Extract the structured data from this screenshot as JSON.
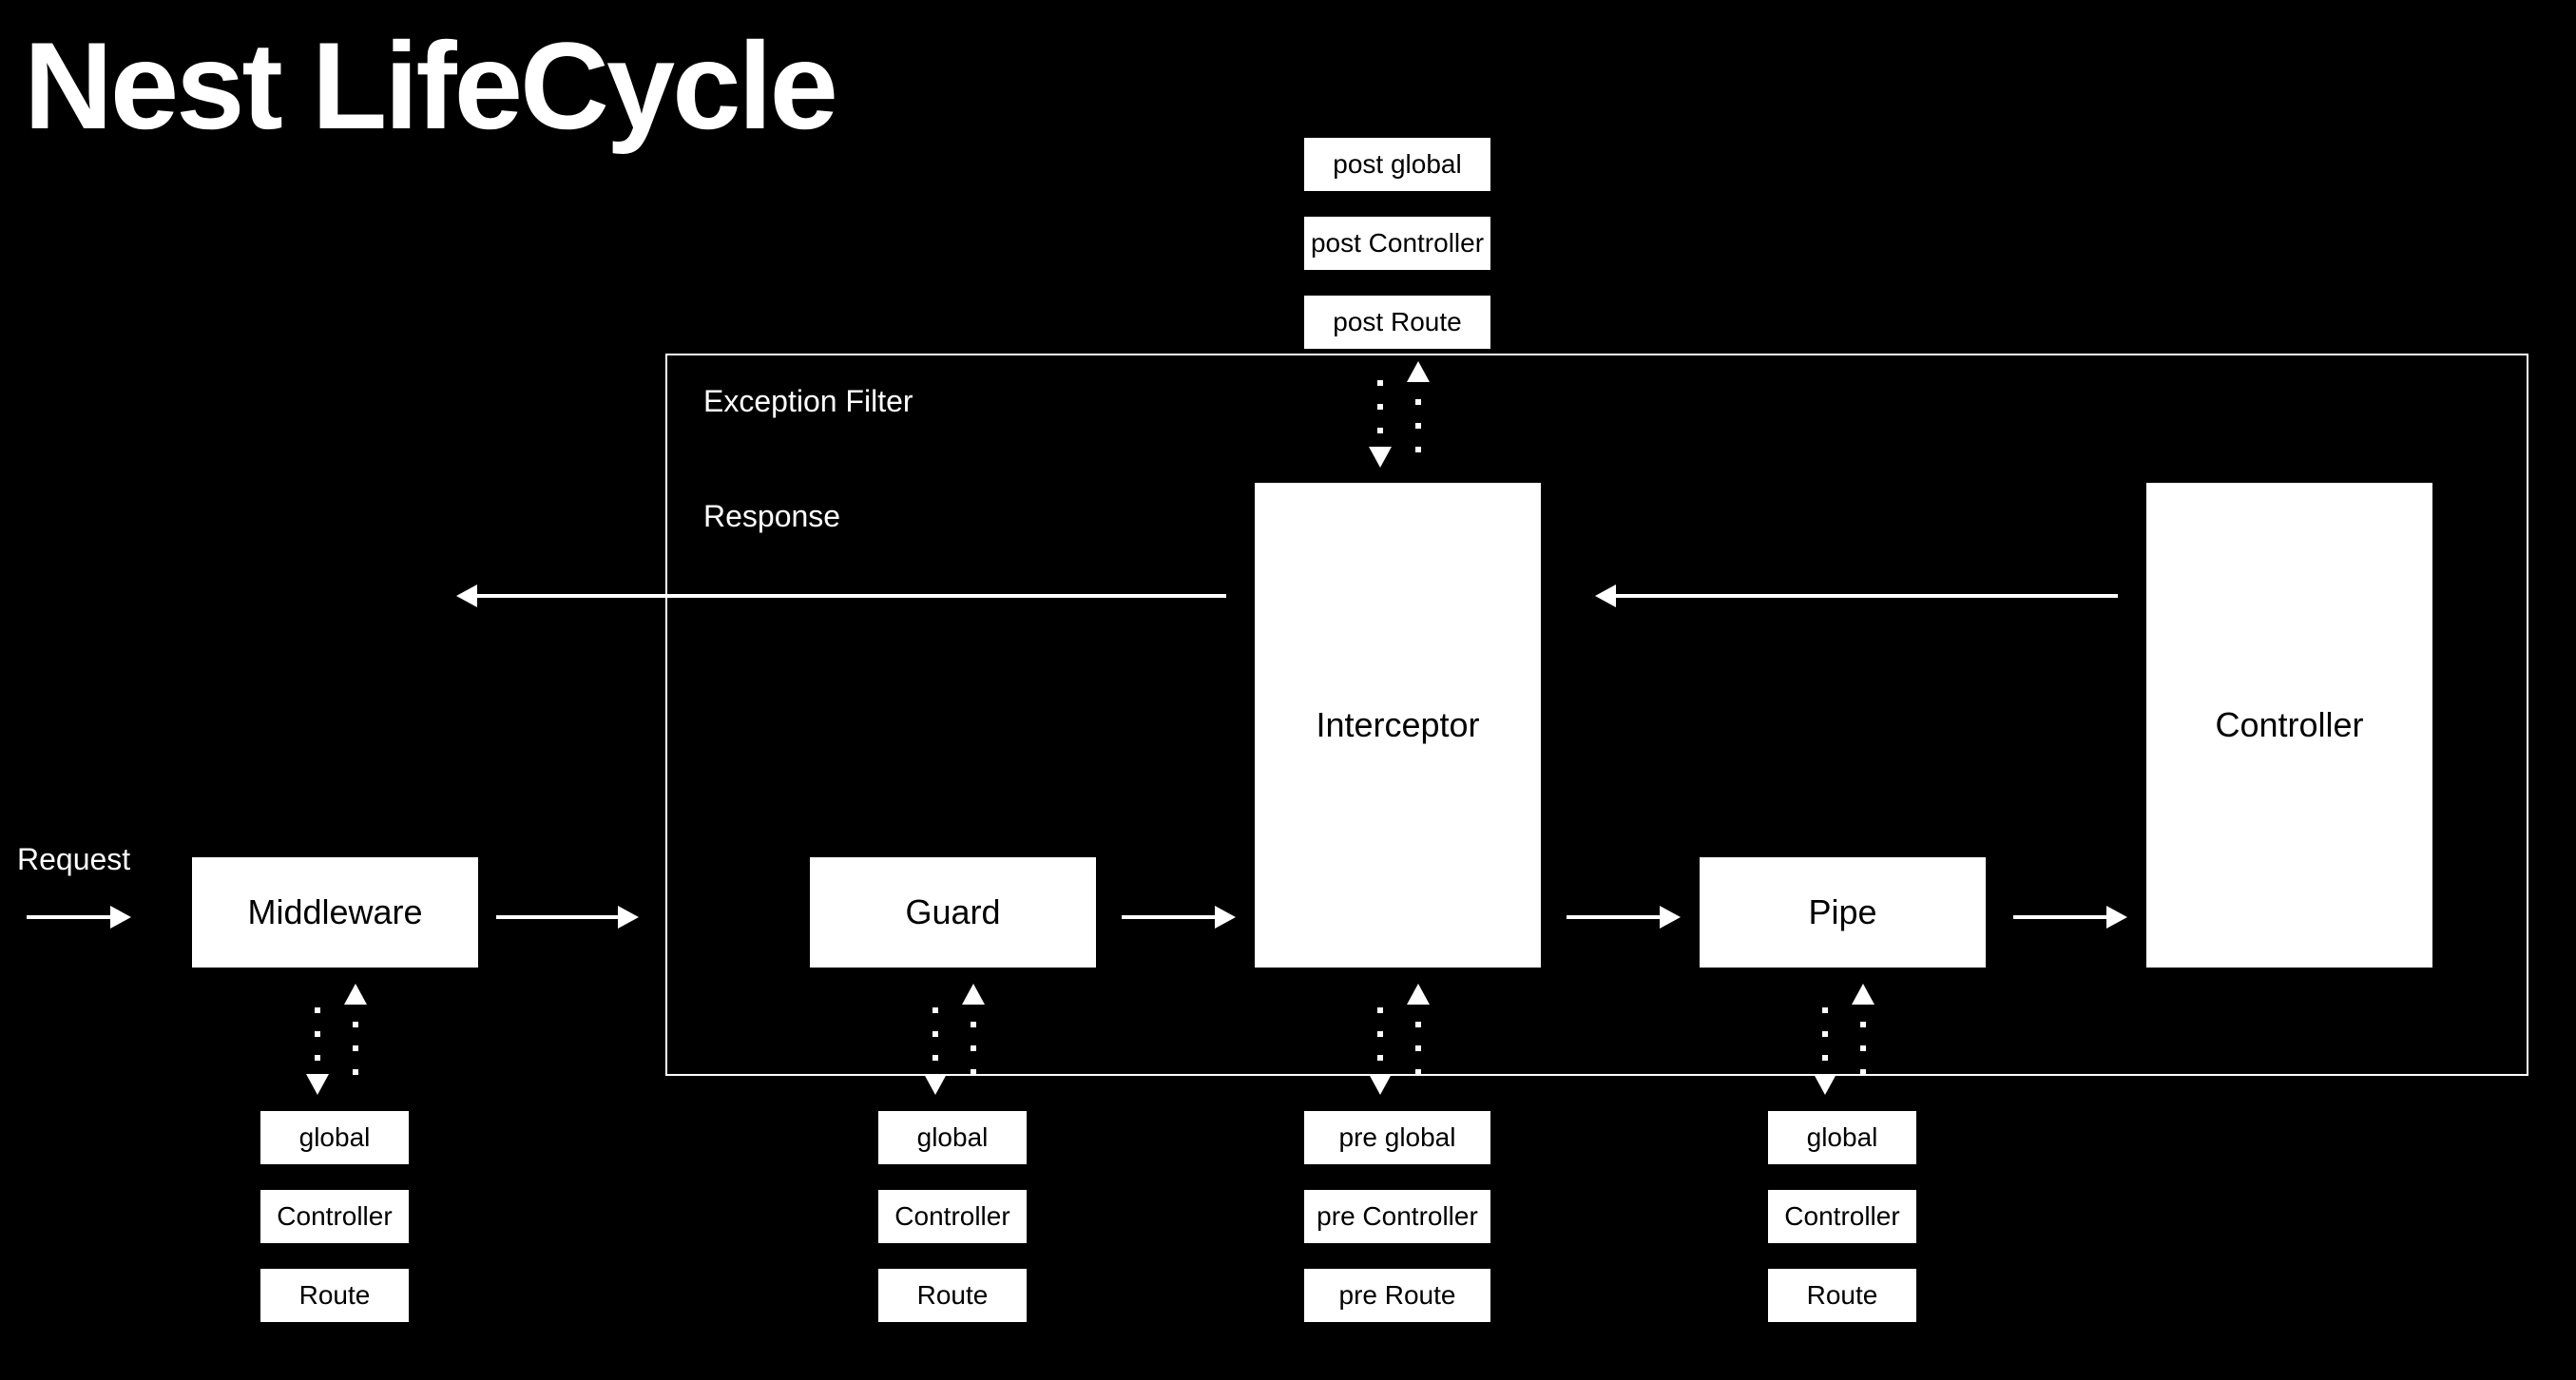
{
  "title": "Nest LifeCycle",
  "labels": {
    "request": "Request",
    "response": "Response",
    "exceptionFilter": "Exception Filter"
  },
  "main": {
    "middleware": "Middleware",
    "guard": "Guard",
    "interceptor": "Interceptor",
    "pipe": "Pipe",
    "controller": "Controller"
  },
  "middlewareScopes": {
    "0": "global",
    "1": "Controller",
    "2": "Route"
  },
  "guardScopes": {
    "0": "global",
    "1": "Controller",
    "2": "Route"
  },
  "pipeScopes": {
    "0": "global",
    "1": "Controller",
    "2": "Route"
  },
  "interceptorPre": {
    "0": "pre global",
    "1": "pre Controller",
    "2": "pre Route"
  },
  "interceptorPost": {
    "0": "post global",
    "1": "post Controller",
    "2": "post Route"
  }
}
